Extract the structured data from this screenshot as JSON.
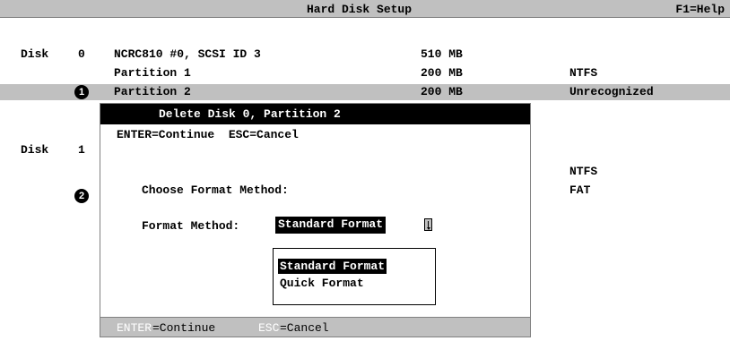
{
  "header": {
    "title": "Hard Disk Setup",
    "help": "F1=Help"
  },
  "disks": {
    "disk0": {
      "label": "Disk",
      "number": "0",
      "name": "NCRC810 #0, SCSI ID 3",
      "size": "510 MB"
    },
    "disk0_partitions": [
      {
        "name": "Partition 1",
        "size": "200 MB",
        "fs": "NTFS"
      },
      {
        "name": "Partition 2",
        "size": "200 MB",
        "fs": "Unrecognized"
      }
    ],
    "disk1": {
      "label": "Disk",
      "number": "1"
    },
    "disk1_fs": [
      "NTFS",
      "FAT"
    ]
  },
  "callouts": [
    "1",
    "2"
  ],
  "dialog": {
    "title": "Delete Disk 0, Partition 2",
    "top_hint": "ENTER=Continue  ESC=Cancel",
    "prompt": "Choose Format Method:",
    "field_label": "Format Method:",
    "selected_value": "Standard Format",
    "options": [
      "Standard Format",
      "Quick Format"
    ],
    "footer": {
      "enter_key": "ENTER",
      "enter_action": "=Continue",
      "esc_key": "ESC",
      "esc_action": "=Cancel"
    }
  },
  "colors": {
    "bar_gray": "#c0c0c0",
    "highlight": "#000000",
    "background": "#ffffff"
  }
}
